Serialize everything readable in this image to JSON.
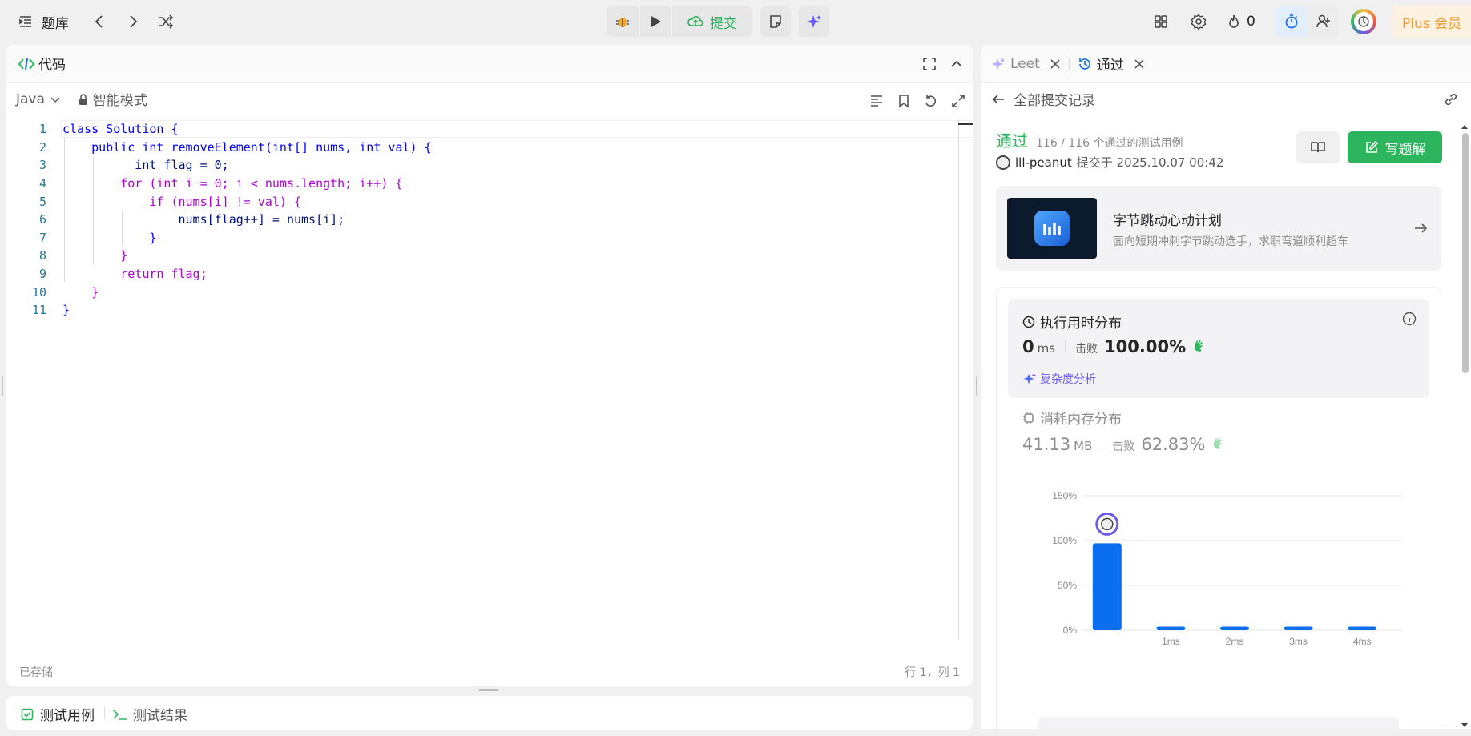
{
  "topbar": {
    "problem_bank_label": "题库",
    "submit_label": "提交",
    "streak_count": "0",
    "plus_label": "Plus 会员"
  },
  "code_panel": {
    "title": "代码",
    "language": "Java",
    "mode": "智能模式",
    "saved_status": "已存储",
    "cursor_position": "行 1，列 1",
    "line_numbers": [
      "1",
      "2",
      "3",
      "4",
      "5",
      "6",
      "7",
      "8",
      "9",
      "10",
      "11"
    ],
    "code_lines": [
      "class Solution {",
      "    public int removeElement(int[] nums, int val) {",
      "          int flag = 0;",
      "        for (int i = 0; i < nums.length; i++) {",
      "            if (nums[i] != val) {",
      "                nums[flag++] = nums[i];",
      "            }",
      "        }",
      "        return flag;",
      "    }",
      "}"
    ]
  },
  "test_panel": {
    "testcase_tab": "测试用例",
    "result_tab": "测试结果"
  },
  "right_panel": {
    "tabs": [
      {
        "label": "Leet"
      },
      {
        "label": "通过"
      }
    ],
    "back_label": "全部提交记录",
    "status": "通过",
    "testcases": "116 / 116 个通过的测试用例",
    "username": "lll-peanut",
    "submitted_at": "提交于 2025.10.07 00:42",
    "write_solution_label": "写题解",
    "promo": {
      "title": "字节跳动心动计划",
      "subtitle": "面向短期冲刺字节跳动选手，求职弯道顺利超车"
    },
    "runtime": {
      "title": "执行用时分布",
      "value": "0",
      "unit": "ms",
      "beats_label": "击败",
      "beats": "100.00%",
      "analysis_label": "复杂度分析"
    },
    "memory": {
      "title": "消耗内存分布",
      "value": "41.13",
      "unit": "MB",
      "beats_label": "击败",
      "beats": "62.83%"
    }
  },
  "colors": {
    "accent_green": "#2db55d",
    "bar_blue": "#0a6ef0",
    "promo_bg": "#0c1a2e",
    "plus_orange": "#f09a2a"
  },
  "chart_data": {
    "type": "bar",
    "categories": [
      "",
      "1ms",
      "2ms",
      "3ms",
      "4ms"
    ],
    "values": [
      97,
      4,
      4,
      4,
      4
    ],
    "yticks": [
      "0%",
      "50%",
      "100%",
      "150%"
    ],
    "ylim": [
      0,
      150
    ],
    "grid": true
  }
}
